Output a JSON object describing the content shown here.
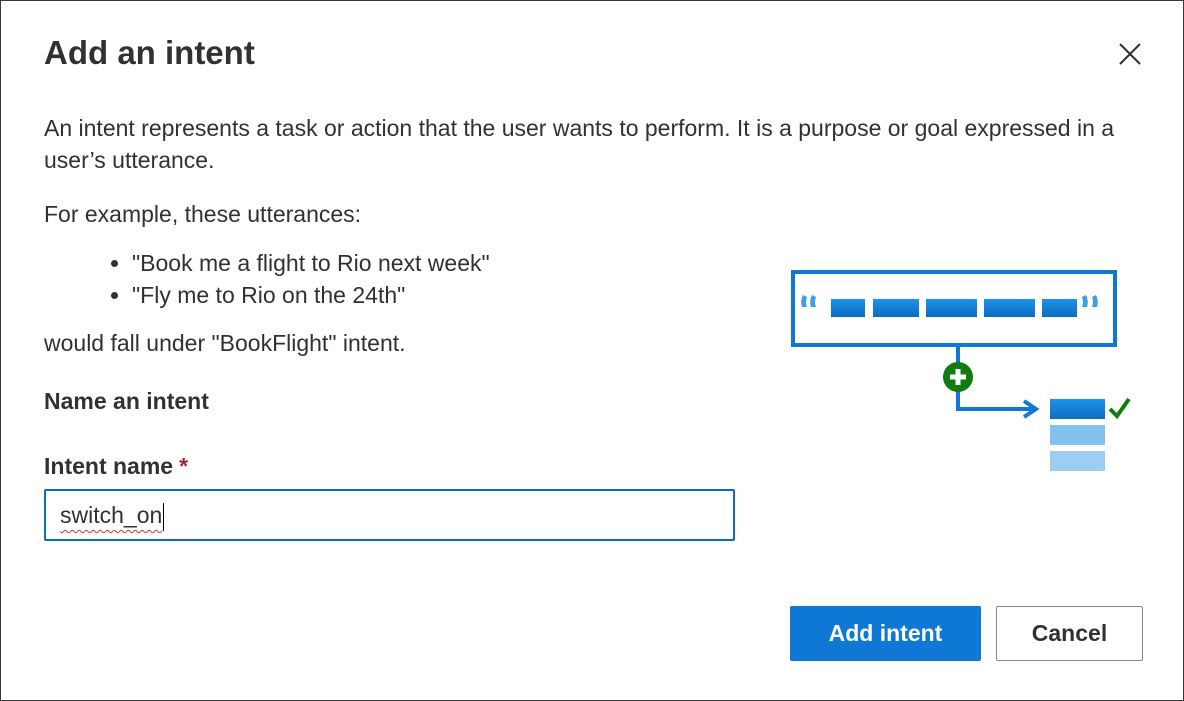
{
  "dialog": {
    "title": "Add an intent",
    "close_icon": "close-icon",
    "description": "An intent represents a task or action that the user wants to perform. It is a purpose or goal expressed in a user’s utterance.",
    "example_lead": "For example, these utterances:",
    "examples": [
      "\"Book me a flight to Rio next week\"",
      "\"Fly me to Rio on the 24th\""
    ],
    "example_tail": "would fall under \"BookFlight\" intent.",
    "section_heading": "Name an intent",
    "field": {
      "label": "Intent name",
      "required_mark": "*",
      "value": "switch_on"
    },
    "illustration": {
      "icons": [
        "open-quote-icon",
        "close-quote-icon",
        "add-circle-icon",
        "arrow-right-icon",
        "checkmark-icon"
      ],
      "accent_color": "#0f78d4",
      "success_color": "#107c10"
    },
    "buttons": {
      "primary_label": "Add intent",
      "secondary_label": "Cancel"
    },
    "colors": {
      "primary": "#0f78d4",
      "focus_border": "#0f6cbd",
      "required": "#a4262c",
      "text": "#323130"
    }
  }
}
